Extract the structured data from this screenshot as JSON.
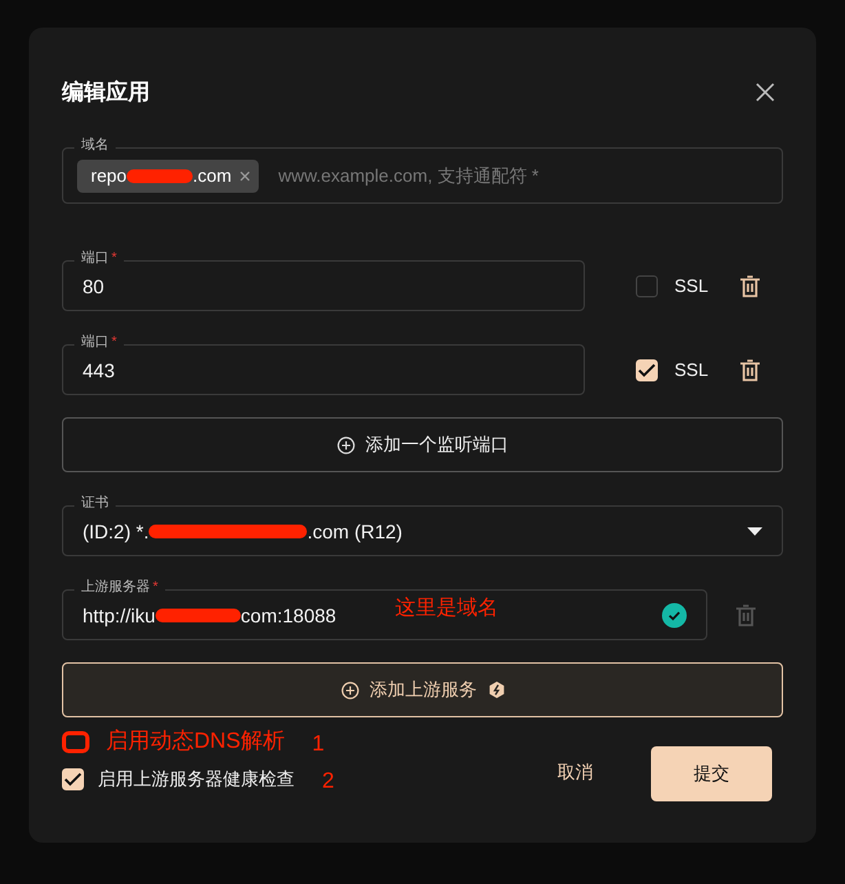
{
  "dialog": {
    "title": "编辑应用"
  },
  "domain": {
    "label": "域名",
    "tags": [
      {
        "start": "repo",
        "end": ".com"
      }
    ],
    "placeholder": "www.example.com, 支持通配符 *"
  },
  "ports": [
    {
      "label": "端口",
      "required_mark": "*",
      "value": "80",
      "ssl_label": "SSL",
      "ssl": false
    },
    {
      "label": "端口",
      "required_mark": "*",
      "value": "443",
      "ssl_label": "SSL",
      "ssl": true
    }
  ],
  "add_port_button": "添加一个监听端口",
  "certificate": {
    "label": "证书",
    "value_start": "(ID:2) *.",
    "value_end": ".com (R12)"
  },
  "upstreams": [
    {
      "label": "上游服务器",
      "required_mark": "*",
      "value_start": "http://iku",
      "value_end": "com:18088",
      "note": "这里是域名",
      "valid": true,
      "removable": false
    }
  ],
  "add_upstream_button": "添加上游服务",
  "options": [
    {
      "label": "启用动态DNS解析",
      "checked": false,
      "annotated": true,
      "note": "1"
    },
    {
      "label": "启用上游服务器健康检查",
      "checked": true,
      "annotated": false,
      "note": "2"
    }
  ],
  "buttons": {
    "cancel": "取消",
    "submit": "提交"
  }
}
